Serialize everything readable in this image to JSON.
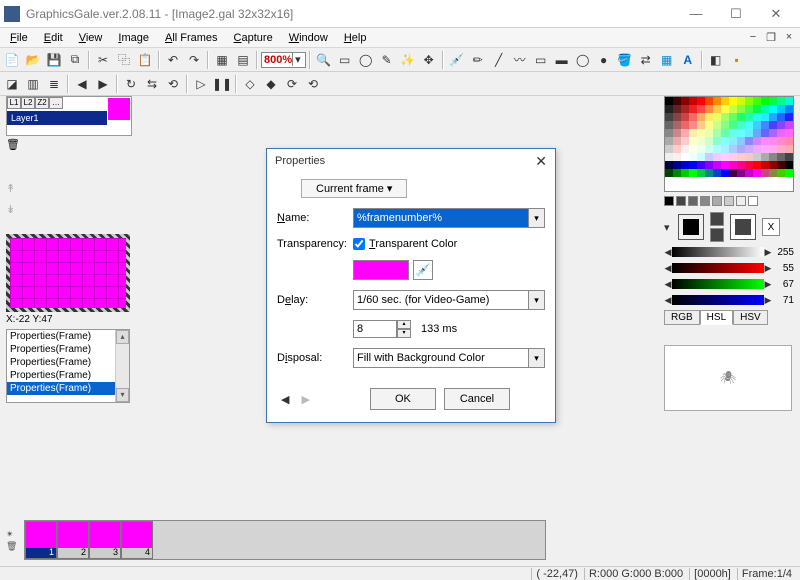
{
  "titlebar": {
    "title": "GraphicsGale.ver.2.08.11 - [Image2.gal 32x32x16]"
  },
  "winbtns": {
    "min": "—",
    "max": "☐",
    "close": "✕"
  },
  "menu": {
    "file": "File",
    "edit": "Edit",
    "view": "View",
    "image": "Image",
    "allframes": "All Frames",
    "capture": "Capture",
    "window": "Window",
    "help": "Help"
  },
  "mdi": {
    "min": "−",
    "restore": "❐",
    "close": "×"
  },
  "zoom": "800%",
  "layer": {
    "name": "Layer1"
  },
  "coord": "X:-22 Y:47",
  "history": [
    "Properties(Frame)",
    "Properties(Frame)",
    "Properties(Frame)",
    "Properties(Frame)",
    "Properties(Frame)"
  ],
  "colorswatches": {
    "x_label": "X"
  },
  "sliders": {
    "gray": "255",
    "r": "55",
    "g": "67",
    "b": "71"
  },
  "colortabs": {
    "rgb": "RGB",
    "hsl": "HSL",
    "hsv": "HSV"
  },
  "frames": {
    "labels": [
      "1",
      "2",
      "3",
      "4"
    ]
  },
  "status": {
    "coord": "( -22,47)",
    "rgb": "R:000 G:000 B:000",
    "hex": "[0000h]",
    "frame": "Frame:1/4"
  },
  "dialog": {
    "title": "Properties",
    "tab": "Current frame ▾",
    "name_lbl": "Name:",
    "name_val": "%framenumber%",
    "transp_lbl": "Transparency:",
    "transp_chk": "Transparent Color",
    "delay_lbl": "Delay:",
    "delay_combo": "1/60 sec. (for Video-Game)",
    "delay_spin": "8",
    "delay_ms": "133 ms",
    "disposal_lbl": "Disposal:",
    "disposal_val": "Fill with Background Color",
    "ok": "OK",
    "cancel": "Cancel"
  }
}
